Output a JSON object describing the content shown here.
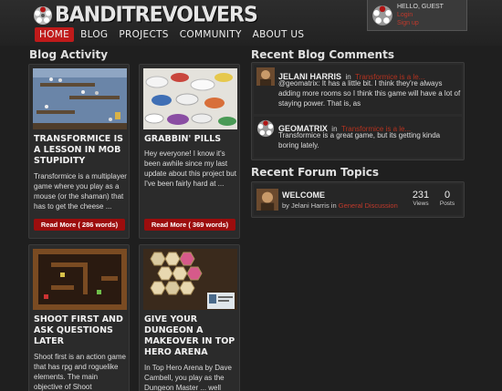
{
  "header": {
    "logo_text": "BANDITREVOLVERS",
    "user_greeting": "HELLO, GUEST",
    "login_label": "Login",
    "signup_label": "Sign up"
  },
  "nav": {
    "items": [
      {
        "label": "HOME",
        "active": true
      },
      {
        "label": "BLOG",
        "active": false
      },
      {
        "label": "PROJECTS",
        "active": false
      },
      {
        "label": "COMMUNITY",
        "active": false
      },
      {
        "label": "ABOUT US",
        "active": false
      }
    ]
  },
  "blog": {
    "title": "Blog Activity",
    "posts": [
      {
        "title": "TRANSFORMICE IS A LESSON IN MOB STUPIDITY",
        "excerpt": "Transformice is a multiplayer game where you play as a mouse (or the shaman) that has to get the cheese ...",
        "read_more": "Read More ( 286 words)"
      },
      {
        "title": "GRABBIN' PILLS",
        "excerpt": "Hey everyone! I know it's been awhile since my last update about this project but I've been fairly hard at ...",
        "read_more": "Read More ( 369 words)"
      },
      {
        "title": "SHOOT FIRST AND ASK QUESTIONS LATER",
        "excerpt": "Shoot first is an action game that has rpg and roguelike elements. The main objective of Shoot"
      },
      {
        "title": "GIVE YOUR DUNGEON A MAKEOVER IN TOP HERO ARENA",
        "excerpt": "In Top Hero Arena by Dave Cambell, you play as the Dungeon Master ... well"
      }
    ]
  },
  "comments": {
    "title": "Recent Blog Comments",
    "items": [
      {
        "author": "JELANI HARRIS",
        "in_label": "in",
        "post": "Transformice is a le...",
        "text": "@geomatrix: It has a little bit. I think they're always adding more rooms so I think this game will have a lot of staying power. That is, as"
      },
      {
        "author": "GEOMATRIX",
        "in_label": "in",
        "post": "Transformice is a le...",
        "text": "Transformice is a great game, but its getting kinda boring lately."
      }
    ]
  },
  "forum": {
    "title": "Recent Forum Topics",
    "topics": [
      {
        "title": "WELCOME",
        "by_label": "by",
        "author": "Jelani Harris",
        "in_label": "in",
        "category": "General Discussion",
        "views": "231",
        "views_label": "Views",
        "posts": "0",
        "posts_label": "Posts"
      }
    ]
  },
  "colors": {
    "accent": "#c01a1a",
    "link": "#b5321f",
    "background": "#1f1f1f",
    "panel": "#2b2b2b"
  }
}
